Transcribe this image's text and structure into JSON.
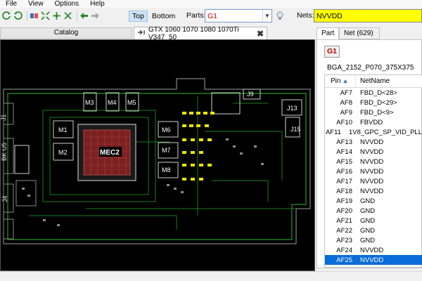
{
  "menu": {
    "file": "File",
    "view": "View",
    "options": "Options",
    "help": "Help"
  },
  "toolbar": {
    "top_label": "Top",
    "bottom_label": "Bottom",
    "parts_label": "Parts:",
    "parts_value": "G1",
    "nets_label": "Nets:",
    "nets_value": "NVVDD",
    "accent": "#ffff00"
  },
  "catalog": {
    "title": "Catalog"
  },
  "document_tab": {
    "title": "GTX 1060 1070 1080 1070Ti V347_50"
  },
  "side_tabs": {
    "part": "Part",
    "net": "Net (629)"
  },
  "part_panel": {
    "part_name": "G1",
    "package": "BGA_2152_P070_375X375",
    "col_pin": "Pin",
    "col_net": "NetName",
    "rows": [
      {
        "pin": "AF7",
        "net": "FBD_D<28>"
      },
      {
        "pin": "AF8",
        "net": "FBD_D<29>"
      },
      {
        "pin": "AF9",
        "net": "FBD_D<9>"
      },
      {
        "pin": "AF10",
        "net": "FBVDD"
      },
      {
        "pin": "AF11",
        "net": "1V8_GPC_SP_VID_PLL"
      },
      {
        "pin": "AF13",
        "net": "NVVDD"
      },
      {
        "pin": "AF14",
        "net": "NVVDD"
      },
      {
        "pin": "AF15",
        "net": "NVVDD"
      },
      {
        "pin": "AF16",
        "net": "NVVDD"
      },
      {
        "pin": "AF17",
        "net": "NVVDD"
      },
      {
        "pin": "AF18",
        "net": "NVVDD"
      },
      {
        "pin": "AF19",
        "net": "GND"
      },
      {
        "pin": "AF20",
        "net": "GND"
      },
      {
        "pin": "AF21",
        "net": "GND"
      },
      {
        "pin": "AF22",
        "net": "GND"
      },
      {
        "pin": "AF23",
        "net": "GND"
      },
      {
        "pin": "AF24",
        "net": "NVVDD"
      },
      {
        "pin": "AF25",
        "net": "NVVDD"
      }
    ],
    "selected_index": 17
  },
  "board": {
    "chip_label": "MEC2",
    "components": [
      "M1",
      "M2",
      "M3",
      "M4",
      "M5",
      "M6",
      "M7",
      "M8",
      "J9",
      "J13",
      "J15",
      "J1",
      "U5",
      "J4"
    ]
  }
}
